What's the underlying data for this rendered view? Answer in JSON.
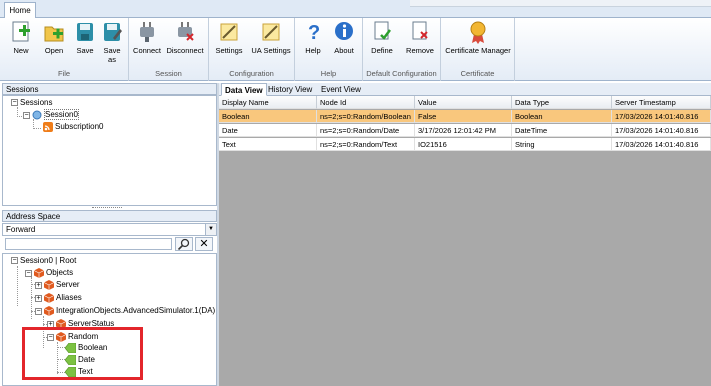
{
  "ribbon": {
    "tab": "Home",
    "buttons": {
      "new": "New",
      "open": "Open",
      "save": "Save",
      "save_as": "Save\nas",
      "connect": "Connect",
      "disconnect": "Disconnect",
      "settings": "Settings",
      "ua_settings": "UA Settings",
      "help": "Help",
      "about": "About",
      "define": "Define",
      "remove": "Remove",
      "certificate_manager": "Certificate Manager"
    },
    "groups": {
      "file": "File",
      "session": "Session",
      "configuration": "Configuration",
      "help": "Help",
      "default_configuration": "Default Configuration",
      "certificate": "Certificate"
    }
  },
  "sessions_panel": {
    "title": "Sessions",
    "nodes": [
      "Sessions",
      "Session0",
      "Subscription0"
    ]
  },
  "address_space": {
    "title": "Address Space",
    "direction": "Forward",
    "search_value": "",
    "nodes": [
      "Session0 | Root",
      "Objects",
      "Server",
      "Aliases",
      "IntegrationObjects.AdvancedSimulator.1(DA)",
      "ServerStatus",
      "Random",
      "Boolean",
      "Date",
      "Text"
    ]
  },
  "views": {
    "tabs": [
      "Data View",
      "History View",
      "Event View"
    ],
    "active": "Data View"
  },
  "data_view": {
    "columns": [
      "Display Name",
      "Node Id",
      "Value",
      "Data Type",
      "Server Timestamp"
    ],
    "rows": [
      [
        "Boolean",
        "ns=2;s=0:Random/Boolean",
        "False",
        "Boolean",
        "17/03/2026 14:01:40.816"
      ],
      [
        "Date",
        "ns=2;s=0:Random/Date",
        "3/17/2026 12:01:42 PM",
        "DateTime",
        "17/03/2026 14:01:40.816"
      ],
      [
        "Text",
        "ns=2;s=0:Random/Text",
        "IO21516",
        "String",
        "17/03/2026 14:01:40.816"
      ]
    ],
    "selected_row": 0
  },
  "colors": {
    "selection": "#f9c77d",
    "highlight_box": "#e3262b",
    "grid_background": "#a9a9a9"
  }
}
